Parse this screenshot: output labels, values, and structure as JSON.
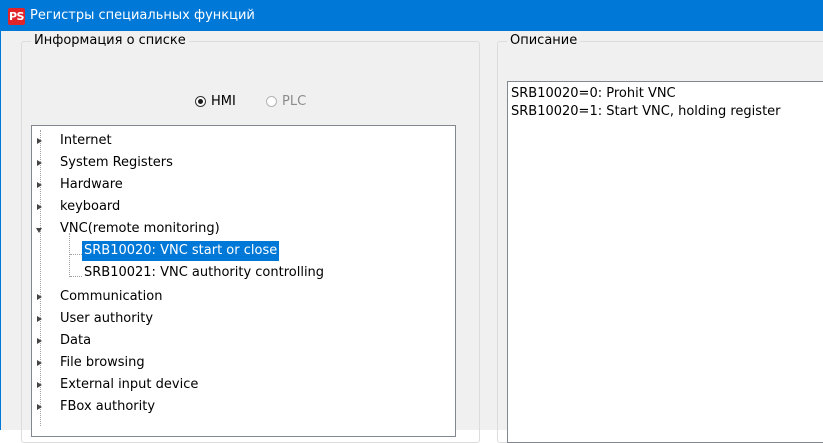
{
  "window": {
    "app_icon_text": "PS",
    "title": "Регистры специальных функций"
  },
  "list_info": {
    "legend": "Информация о списке",
    "radios": [
      {
        "label": "HMI",
        "selected": true,
        "enabled": true
      },
      {
        "label": "PLC",
        "selected": false,
        "enabled": false
      }
    ]
  },
  "tree": {
    "nodes": [
      {
        "label": "Internet",
        "expanded": false
      },
      {
        "label": "System Registers",
        "expanded": false
      },
      {
        "label": "Hardware",
        "expanded": false
      },
      {
        "label": "keyboard",
        "expanded": false
      },
      {
        "label": "VNC(remote monitoring)",
        "expanded": true,
        "children": [
          {
            "label": "SRB10020: VNC start or close",
            "selected": true
          },
          {
            "label": "SRB10021: VNC authority controlling",
            "selected": false
          }
        ]
      },
      {
        "label": "Communication",
        "expanded": false
      },
      {
        "label": "User authority",
        "expanded": false
      },
      {
        "label": "Data",
        "expanded": false
      },
      {
        "label": "File browsing",
        "expanded": false
      },
      {
        "label": "External input device",
        "expanded": false
      },
      {
        "label": "FBox authority",
        "expanded": false
      }
    ]
  },
  "description": {
    "legend": "Описание",
    "lines": [
      "SRB10020=0: Prohit VNC",
      "SRB10020=1: Start VNC, holding register"
    ]
  },
  "colors": {
    "titlebar": "#0078d7",
    "selection": "#0078d7",
    "icon_bg": "#e0242a"
  }
}
